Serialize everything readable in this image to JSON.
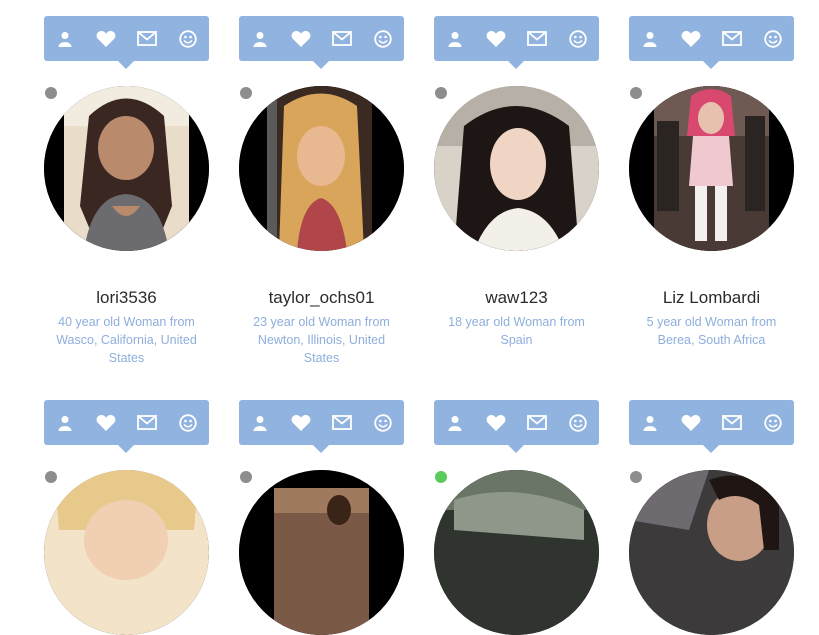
{
  "colors": {
    "toolbar": "#91b3e0",
    "status_offline": "#8d8d8d",
    "status_online": "#5cc95c",
    "link_text": "#8eaedc"
  },
  "toolbar_icons": [
    "user-icon",
    "heart-icon",
    "envelope-icon",
    "smiley-icon"
  ],
  "profiles": [
    {
      "username": "lori3536",
      "description": "40 year old Woman from Wasco, California, United States",
      "online": false
    },
    {
      "username": "taylor_ochs01",
      "description": "23 year old Woman from Newton, Illinois, United States",
      "online": false
    },
    {
      "username": "waw123",
      "description": "18 year old Woman from Spain",
      "online": false
    },
    {
      "username": "Liz Lombardi",
      "description": "5 year old Woman from Berea, South Africa",
      "online": false
    },
    {
      "username": "",
      "description": "",
      "online": false
    },
    {
      "username": "",
      "description": "",
      "online": false
    },
    {
      "username": "",
      "description": "",
      "online": true
    },
    {
      "username": "",
      "description": "",
      "online": false
    }
  ]
}
